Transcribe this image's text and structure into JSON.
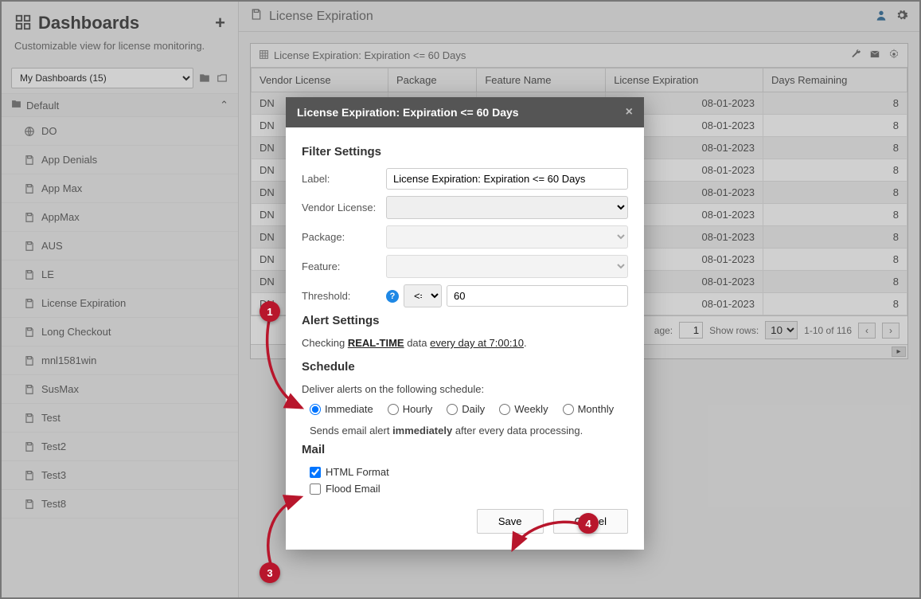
{
  "sidebar": {
    "title": "Dashboards",
    "subtitle": "Customizable view for license monitoring.",
    "selector": "My Dashboards (15)",
    "group": "Default",
    "items": [
      {
        "label": "DO",
        "icon": "globe"
      },
      {
        "label": "App Denials",
        "icon": "save"
      },
      {
        "label": "App Max",
        "icon": "save"
      },
      {
        "label": "AppMax",
        "icon": "save"
      },
      {
        "label": "AUS",
        "icon": "save"
      },
      {
        "label": "LE",
        "icon": "save"
      },
      {
        "label": "License Expiration",
        "icon": "save"
      },
      {
        "label": "Long Checkout",
        "icon": "save"
      },
      {
        "label": "mnl1581win",
        "icon": "save"
      },
      {
        "label": "SusMax",
        "icon": "save"
      },
      {
        "label": "Test",
        "icon": "save"
      },
      {
        "label": "Test2",
        "icon": "save"
      },
      {
        "label": "Test3",
        "icon": "save"
      },
      {
        "label": "Test8",
        "icon": "save"
      }
    ]
  },
  "main": {
    "title": "License Expiration",
    "panel_title": "License Expiration: Expiration <= 60 Days",
    "columns": [
      "Vendor License",
      "Package",
      "Feature Name",
      "License Expiration",
      "Days Remaining"
    ],
    "rows": [
      {
        "vendor": "DN",
        "pkg": "",
        "feat": "",
        "exp": "08-01-2023",
        "days": "8"
      },
      {
        "vendor": "DN",
        "pkg": "",
        "feat": "",
        "exp": "08-01-2023",
        "days": "8"
      },
      {
        "vendor": "DN",
        "pkg": "",
        "feat": "",
        "exp": "08-01-2023",
        "days": "8"
      },
      {
        "vendor": "DN",
        "pkg": "",
        "feat": "",
        "exp": "08-01-2023",
        "days": "8"
      },
      {
        "vendor": "DN",
        "pkg": "",
        "feat": "",
        "exp": "08-01-2023",
        "days": "8"
      },
      {
        "vendor": "DN",
        "pkg": "",
        "feat": "",
        "exp": "08-01-2023",
        "days": "8"
      },
      {
        "vendor": "DN",
        "pkg": "",
        "feat": "",
        "exp": "08-01-2023",
        "days": "8"
      },
      {
        "vendor": "DN",
        "pkg": "",
        "feat": "",
        "exp": "08-01-2023",
        "days": "8"
      },
      {
        "vendor": "DN",
        "pkg": "",
        "feat": "",
        "exp": "08-01-2023",
        "days": "8"
      },
      {
        "vendor": "DN",
        "pkg": "",
        "feat": "",
        "exp": "08-01-2023",
        "days": "8"
      }
    ],
    "footer": {
      "page_label": "age:",
      "page_val": "1",
      "showrows_label": "Show rows:",
      "showrows_val": "10",
      "range": "1-10 of 116"
    }
  },
  "modal": {
    "title": "License Expiration: Expiration <= 60 Days",
    "filter_title": "Filter Settings",
    "label_lbl": "Label:",
    "label_val": "License Expiration: Expiration <= 60 Days",
    "vendor_lbl": "Vendor License:",
    "package_lbl": "Package:",
    "feature_lbl": "Feature:",
    "threshold_lbl": "Threshold:",
    "threshold_op": "<=",
    "threshold_val": "60",
    "alert_title": "Alert Settings",
    "alert_prefix": "Checking ",
    "alert_bold": "REAL-TIME",
    "alert_mid": " data ",
    "alert_underline": "every day at 7:00:10",
    "alert_suffix": ".",
    "schedule_title": "Schedule",
    "schedule_sub": "Deliver alerts on the following schedule:",
    "radios": [
      "Immediate",
      "Hourly",
      "Daily",
      "Weekly",
      "Monthly"
    ],
    "sched_desc_pre": "Sends email alert ",
    "sched_desc_bold": "immediately",
    "sched_desc_post": " after every data processing.",
    "mail_title": "Mail",
    "chk_html": "HTML Format",
    "chk_flood": "Flood Email",
    "save": "Save",
    "cancel": "Cancel"
  },
  "callouts": {
    "c1": "1",
    "c3": "3",
    "c4": "4"
  }
}
